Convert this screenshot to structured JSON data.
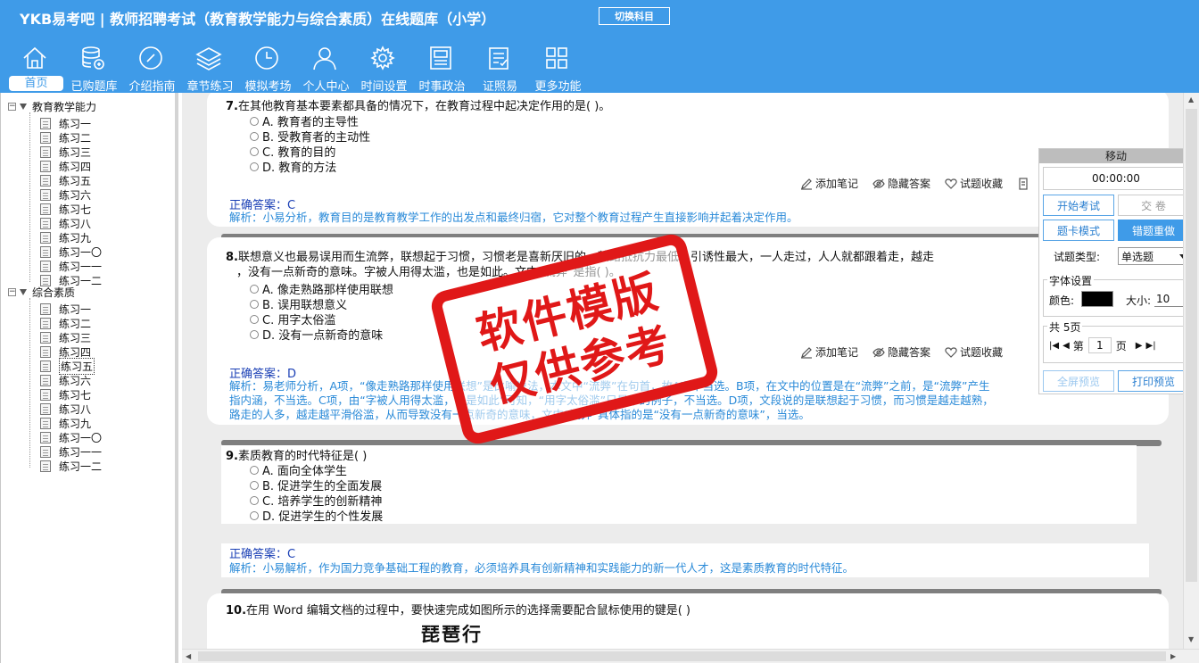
{
  "header": {
    "title": "YKB易考吧 | 教师招聘考试（教育教学能力与综合素质）在线题库（小学）",
    "switch_subject": "切换科目",
    "nav": [
      {
        "label": "首页",
        "icon": "home-icon"
      },
      {
        "label": "已购题库",
        "icon": "database-icon"
      },
      {
        "label": "介绍指南",
        "icon": "compass-icon"
      },
      {
        "label": "章节练习",
        "icon": "layers-icon"
      },
      {
        "label": "模拟考场",
        "icon": "clock-icon"
      },
      {
        "label": "个人中心",
        "icon": "user-icon"
      },
      {
        "label": "时间设置",
        "icon": "gear-icon"
      },
      {
        "label": "时事政治",
        "icon": "news-icon"
      },
      {
        "label": "证照易",
        "icon": "clipboard-icon"
      },
      {
        "label": "更多功能",
        "icon": "grid-icon"
      }
    ]
  },
  "sidebar": {
    "groups": [
      {
        "label": "教育教学能力",
        "items": [
          "练习一",
          "练习二",
          "练习三",
          "练习四",
          "练习五",
          "练习六",
          "练习七",
          "练习八",
          "练习九",
          "练习一〇",
          "练习一一",
          "练习一二"
        ]
      },
      {
        "label": "综合素质",
        "items": [
          "练习一",
          "练习二",
          "练习三",
          "练习四",
          "练习五",
          "练习六",
          "练习七",
          "练习八",
          "练习九",
          "练习一〇",
          "练习一一",
          "练习一二"
        ]
      }
    ],
    "selected": "综合素质/练习五"
  },
  "questions": [
    {
      "num": "7.",
      "stem": "在其他教育基本要素都具备的情况下，在教育过程中起决定作用的是( )。",
      "options": [
        "A. 教育者的主导性",
        "B. 受教育者的主动性",
        "C. 教育的目的",
        "D. 教育的方法"
      ],
      "answer": "正确答案：C",
      "explain": [
        "解析：小易分析，教育目的是教育教学工作的出发点和最终归宿，它对整个教育过程产生直接影响并起着决定作用。"
      ]
    },
    {
      "num": "8.",
      "stem": [
        "联想意义也最易误用而生流弊，联想起于习惯，习惯老是喜新厌旧的，熟路抵抗力最低，引诱性最大，一人走过，人人就都跟着走，越走",
        "，没有一点新奇的意味。字被人用得太滥，也是如此。文中“流弊”是指( )。"
      ],
      "options": [
        "A. 像走熟路那样使用联想",
        "B. 误用联想意义",
        "C. 用字太俗滥",
        "D. 没有一点新奇的意味"
      ],
      "answer": "正确答案：D",
      "explain": [
        "解析：易老师分析，A项，“像走熟路那样使用联想”是比喻说法，本文中“流弊”在句首，故A项不当选。B项，在文中的位置是在“流弊”之前，是“流弊”产生",
        "指内涵，不当选。C项，由“字被人用得太滥，也是如此”可知，“用字太俗滥”只是举的例子，不当选。D项，文段说的是联想起于习惯，而习惯是越走越熟，",
        "路走的人多，越走越平滑俗滥，从而导致没有一点新奇的意味，文中“流弊”具体指的是“没有一点新奇的意味”，当选。"
      ]
    },
    {
      "num": "9.",
      "stem": "素质教育的时代特征是( )",
      "options": [
        "A. 面向全体学生",
        "B. 促进学生的全面发展",
        "C. 培养学生的创新精神",
        "D. 促进学生的个性发展"
      ],
      "answer": "正确答案：C",
      "explain": [
        "解析：小易解析，作为国力竞争基础工程的教育，必须培养具有创新精神和实践能力的新一代人才，这是素质教育的时代特征。"
      ]
    },
    {
      "num": "10.",
      "stem": "在用 Word 编辑文档的过程中，要快速完成如图所示的选择需要配合鼠标使用的键是(   )",
      "image_text": "琵琶行"
    }
  ],
  "actions": {
    "add_note": "添加笔记",
    "hide_answer": "隐藏答案",
    "favorite": "试题收藏"
  },
  "panel": {
    "move": "移动",
    "timer": "00:00:00",
    "start_exam": "开始考试",
    "submit": "交   卷",
    "card_mode": "题卡模式",
    "wrong_redo": "错题重做",
    "qtype_label": "试题类型:",
    "qtype_value": "单选题",
    "font_legend": "字体设置",
    "color_label": "颜色:",
    "size_label": "大小:",
    "size_value": "10",
    "pages_legend": "共 5页",
    "page_prefix": "第",
    "page_value": "1",
    "page_suffix": "页",
    "fullscreen": "全屏预览",
    "print": "打印预览"
  },
  "watermark": {
    "line1": "软件模版",
    "line2": "仅供参考"
  },
  "colors": {
    "header": "#3f9be8",
    "answer": "#1a3fb5",
    "explain": "#2a8ad8",
    "stamp": "#e01818"
  }
}
